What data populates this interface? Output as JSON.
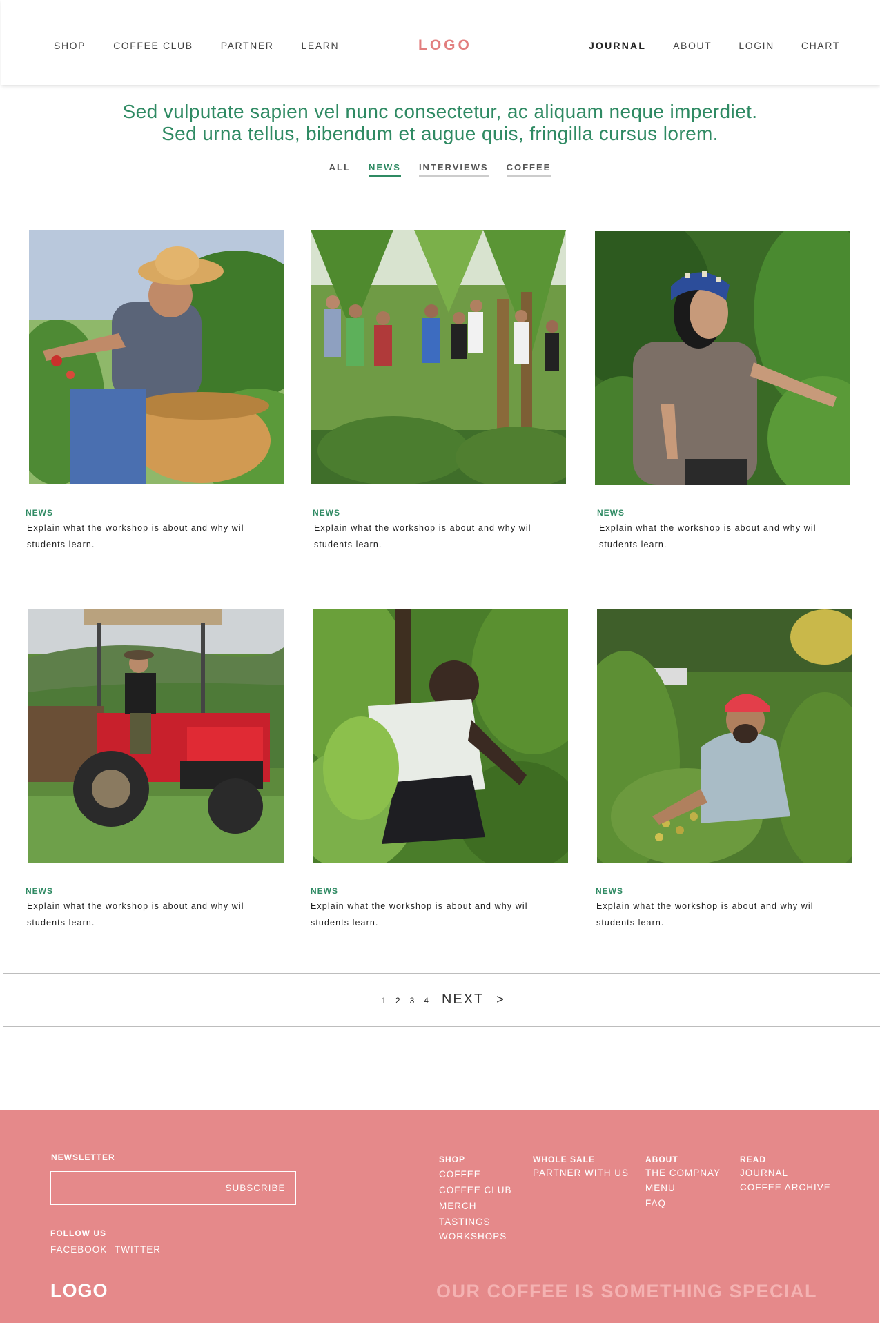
{
  "header": {
    "nav_left": [
      "SHOP",
      "COFFEE CLUB",
      "PARTNER",
      "LEARN"
    ],
    "logo": "LOGO",
    "nav_right": [
      "JOURNAL",
      "ABOUT",
      "LOGIN",
      "CHART"
    ],
    "active_item": "JOURNAL"
  },
  "hero": {
    "line1": "Sed vulputate sapien vel nunc consectetur, ac aliquam neque imperdiet.",
    "line2": "Sed urna tellus, bibendum et augue quis, fringilla cursus lorem."
  },
  "filters": {
    "items": [
      "ALL",
      "NEWS",
      "INTERVIEWS",
      "COFFEE"
    ],
    "active": "NEWS"
  },
  "cards": [
    {
      "tag": "NEWS",
      "desc_line1": "Explain what the workshop is about and why wil",
      "desc_line2": "students learn.",
      "image": "farmer-straw-hat-basket"
    },
    {
      "tag": "NEWS",
      "desc_line1": "Explain what the workshop is about and why wil",
      "desc_line2": "students learn.",
      "image": "group-in-banana-grove"
    },
    {
      "tag": "NEWS",
      "desc_line1": "Explain what the workshop is about and why wil",
      "desc_line2": "students learn.",
      "image": "woman-blue-headscarf"
    },
    {
      "tag": "NEWS",
      "desc_line1": "Explain what the workshop is about and why wil",
      "desc_line2": "students learn.",
      "image": "man-on-red-tractor"
    },
    {
      "tag": "NEWS",
      "desc_line1": "Explain what the workshop is about and why wil",
      "desc_line2": "students learn.",
      "image": "man-kneeling-plants"
    },
    {
      "tag": "NEWS",
      "desc_line1": "Explain what the workshop is about and why wil",
      "desc_line2": "students learn.",
      "image": "man-red-cap-picking"
    }
  ],
  "pagination": {
    "pages": [
      "1",
      "2",
      "3",
      "4"
    ],
    "current": "1",
    "next": "NEXT",
    "arrow": ">"
  },
  "footer": {
    "newsletter_heading": "NEWSLETTER",
    "subscribe_label": "SUBSCRIBE",
    "follow_heading": "FOLLOW US",
    "social": [
      "FACEBOOK",
      "TWITTER"
    ],
    "columns": [
      {
        "heading": "SHOP",
        "links": [
          "COFFEE",
          "COFFEE CLUB",
          "MERCH",
          "TASTINGS",
          "WORKSHOPS"
        ]
      },
      {
        "heading": "WHOLE SALE",
        "links": [
          "PARTNER WITH US"
        ]
      },
      {
        "heading": "ABOUT",
        "links": [
          "THE COMPNAY",
          "MENU",
          "FAQ"
        ]
      },
      {
        "heading": "READ",
        "links": [
          "JOURNAL",
          "COFFEE ARCHIVE"
        ]
      }
    ],
    "logo": "LOGO",
    "tagline": "OUR COFFEE IS SOMETHING SPECIAL"
  },
  "colors": {
    "accent_green": "#2f8a63",
    "logo_pink": "#e27e7e",
    "footer_bg": "#e5898a",
    "tagline_pink": "#f4b2b2"
  }
}
